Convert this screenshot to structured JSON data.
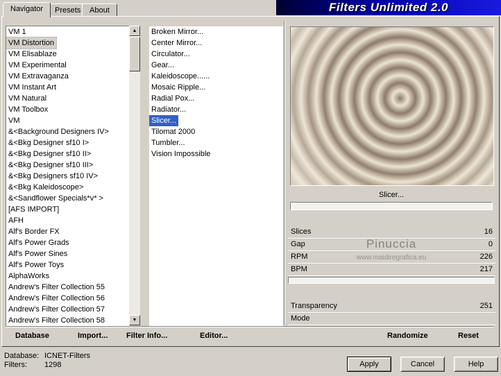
{
  "window": {
    "title": "Filters Unlimited 2.0"
  },
  "tabs": [
    {
      "label": "Navigator",
      "active": true
    },
    {
      "label": "Presets",
      "active": false
    },
    {
      "label": "About",
      "active": false
    }
  ],
  "categories": {
    "selected": "VM Distortion",
    "items": [
      "VM 1",
      "VM Distortion",
      "VM Elisablaze",
      "VM Experimental",
      "VM Extravaganza",
      "VM Instant Art",
      "VM Natural",
      "VM Toolbox",
      "VM",
      "&<Background Designers IV>",
      "&<Bkg Designer sf10 I>",
      "&<Bkg Designer sf10 II>",
      "&<Bkg Designer sf10 III>",
      "&<Bkg Designers sf10 IV>",
      "&<Bkg Kaleidoscope>",
      "&<Sandflower Specials*v* >",
      "[AFS IMPORT]",
      "AFH",
      "Alf's Border FX",
      "Alf's Power Grads",
      "Alf's Power Sines",
      "Alf's Power Toys",
      "AlphaWorks",
      "Andrew's Filter Collection 55",
      "Andrew's Filter Collection 56",
      "Andrew's Filter Collection 57",
      "Andrew's Filter Collection 58"
    ]
  },
  "filters": {
    "selected": "Slicer...",
    "items": [
      "Broken Mirror...",
      "Center Mirror...",
      "Circulator...",
      "Gear...",
      "Kaleidoscope......",
      "Mosaic Ripple...",
      "Radial Pox...",
      "Radiator...",
      "Slicer...",
      "Tilomat 2000",
      "Tumbler...",
      "Vision Impossible"
    ]
  },
  "preview": {
    "filter_name": "Slicer..."
  },
  "params": {
    "group1": [
      {
        "label": "Slices",
        "value": "16"
      },
      {
        "label": "Gap",
        "value": "0"
      },
      {
        "label": "RPM",
        "value": "226"
      },
      {
        "label": "BPM",
        "value": "217"
      }
    ],
    "group2": [
      {
        "label": "Transparency",
        "value": "251"
      },
      {
        "label": "Mode",
        "value": ""
      }
    ]
  },
  "watermark": {
    "line1": "Pinuccia",
    "line2": "www.maidiregrafica.eu"
  },
  "toolbar": {
    "database": "Database",
    "import": "Import...",
    "filter_info": "Filter Info...",
    "editor": "Editor...",
    "randomize": "Randomize",
    "reset": "Reset"
  },
  "status": {
    "database_label": "Database:",
    "database_value": "ICNET-Filters",
    "filters_label": "Filters:",
    "filters_value": "1298"
  },
  "dialog": {
    "apply": "Apply",
    "cancel": "Cancel",
    "help": "Help"
  },
  "colors": {
    "dialog_bg": "#d4d0c8",
    "selection_blue": "#3161c4",
    "banner_blue": "#0000a8"
  }
}
